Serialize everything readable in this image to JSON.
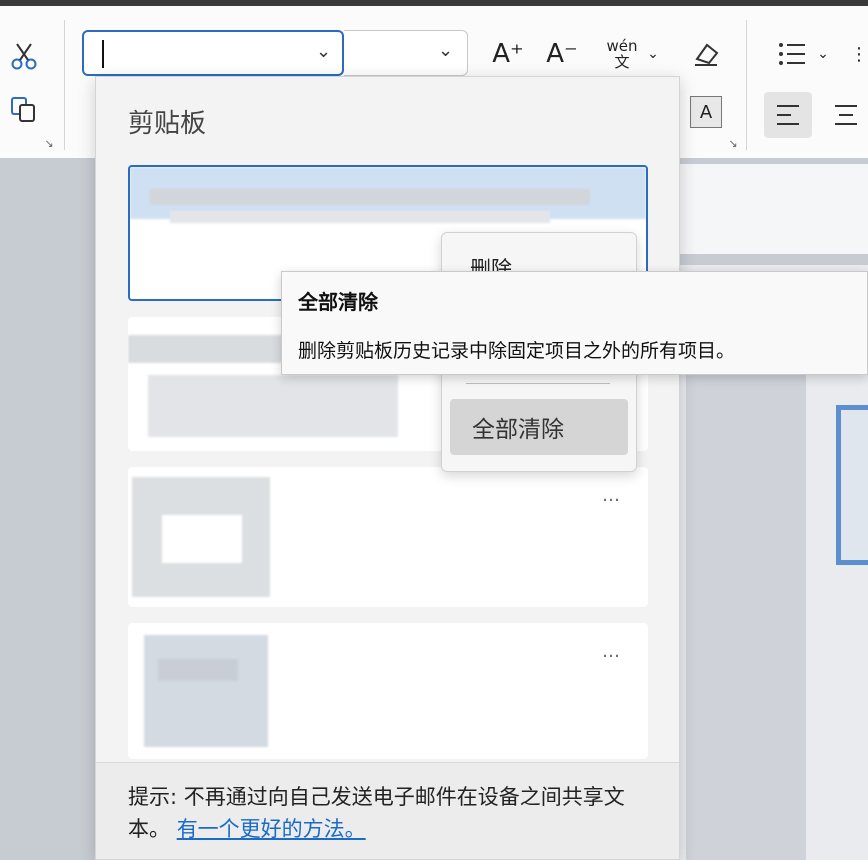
{
  "ribbon": {
    "icons": [
      "scissors-icon",
      "copy-format-icon",
      "grow-font-icon",
      "shrink-font-icon",
      "phonetic-guide-icon",
      "chevron-down-icon",
      "clear-format-icon",
      "bullets-icon",
      "numbering-icon",
      "align-left-icon",
      "align-center-icon",
      "dialog-launcher-icon"
    ],
    "grow_font_glyph": "A⁺",
    "shrink_font_glyph": "A⁻",
    "phonetic_glyph": "wén\n文",
    "char_border_glyph": "A"
  },
  "clipboard": {
    "title": "剪贴板",
    "more_label": "…",
    "tip_text": "提示: 不再通过向自己发送电子邮件在设备之间共享文本。",
    "tip_link": "有一个更好的方法。"
  },
  "context_menu": {
    "top_item": "删除",
    "clear_all": "全部清除"
  },
  "tooltip": {
    "title": "全部清除",
    "description": "删除剪贴板历史记录中除固定项目之外的所有项目。"
  }
}
